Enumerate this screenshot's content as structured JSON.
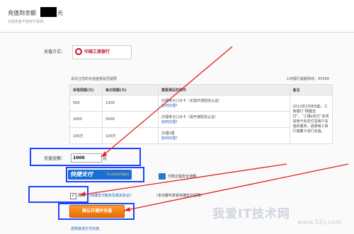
{
  "header": {
    "title": "充值到余额",
    "unit": "元",
    "subtitle": "充值资金不能用于提现。"
  },
  "form": {
    "method_label": "充值方式：",
    "bank_name": "中国工商银行",
    "notice": "请关注您的充值金额是否超限",
    "hotline": "工商银行客服热线：95588",
    "amount_label": "充值金额：",
    "amount_value": "1000",
    "amount_unit": "元"
  },
  "table": {
    "headers": [
      "单笔限额(元)",
      "每日限额(元)",
      "需要满足的条件",
      "备注"
    ],
    "rows": [
      {
        "single": "500",
        "daily": "1000",
        "cond": "办理电子口令卡（无需开通短信认证）",
        "link": "如何办理?"
      },
      {
        "single": "2000",
        "daily": "5000",
        "cond": "办理电子口令卡（需开通短信认证）",
        "link": "如何办理?"
      },
      {
        "single": "100万",
        "daily": "100万",
        "cond": "办理U盾",
        "link": "如何办理?"
      }
    ],
    "note": "2012年2月8日起，工商银行“网银支付”、“工银e支付”关闭信用卡向支付宝账户充值的服务，请使用工商行储蓄卡进行充值。"
  },
  "promo": {
    "logo": "快捷支付",
    "logo_sub": "72小时100%赔付",
    "safe": "付款过程安全流畅"
  },
  "agreement": {
    "checked": "✓",
    "agree": "同意",
    "link": "《快捷支付服务及相关协议》",
    "tail": "（本次都可享受快捷支付保障）"
  },
  "confirm_label": "确认开通并充值",
  "other_link": "选择其他方式充值",
  "watermark": "我爱IT技术网",
  "watermark_url": "www.52ij.com",
  "colors": {
    "highlight": "#1f43ff",
    "arrow": "#e21f1f",
    "confirm": "#f08300",
    "bank": "#c8102e"
  }
}
